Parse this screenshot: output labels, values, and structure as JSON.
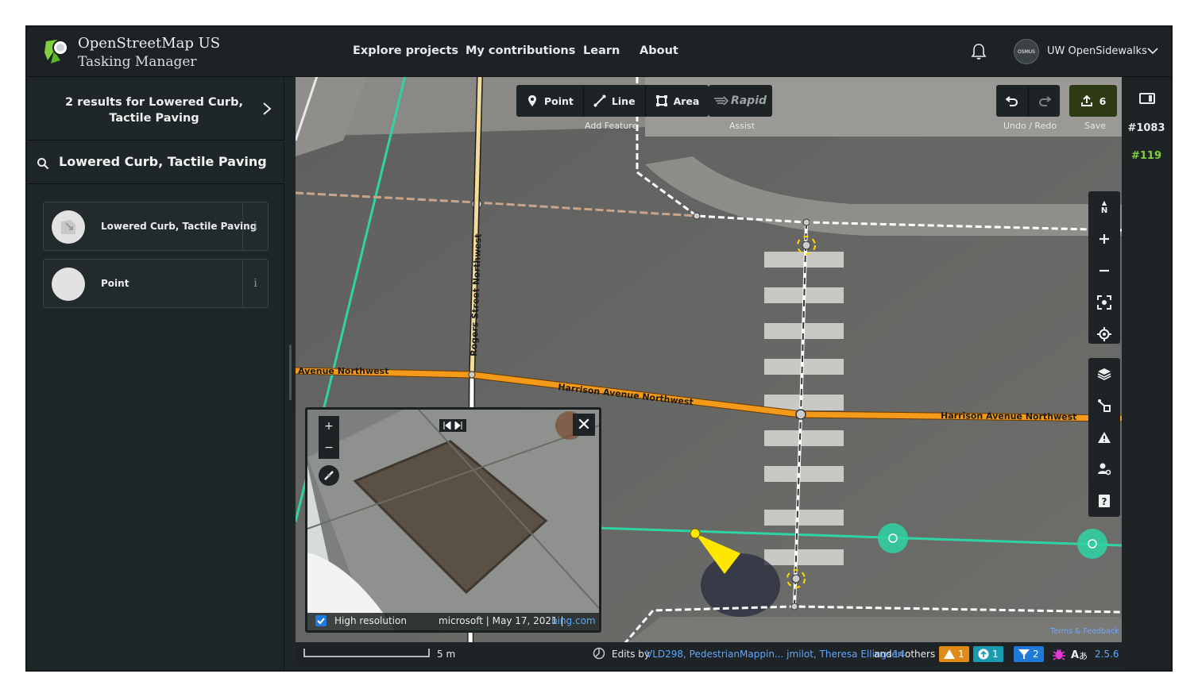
{
  "header": {
    "brand_line1": "OpenStreetMap US",
    "brand_line2": "Tasking Manager",
    "nav": [
      "Explore projects",
      "My contributions",
      "Learn",
      "About"
    ],
    "org_name": "UW OpenSidewalks",
    "avatar_text": "OSMUS"
  },
  "sidebar": {
    "results_title": "2 results for Lowered Curb, Tactile Paving",
    "search_value": "Lowered Curb, Tactile Paving",
    "presets": [
      {
        "label": "Lowered Curb, Tactile Paving",
        "info": "i"
      },
      {
        "label": "Point",
        "info": "i"
      }
    ]
  },
  "toolbar": {
    "point": "Point",
    "line": "Line",
    "area": "Area",
    "add_feature": "Add Feature",
    "rapid": "Rapid",
    "assist": "Assist",
    "undo_redo": "Undo / Redo",
    "save": "Save",
    "save_count": "6"
  },
  "map": {
    "labels": {
      "avenue_nw": "Avenue Northwest",
      "harrison1": "Harrison Avenue Northwest",
      "harrison2": "Harrison Avenue Northwest",
      "rogers": "Rogers Street Northwest"
    },
    "compass": "N",
    "terms": "Terms & Feedback"
  },
  "viewer": {
    "high_res": "High resolution",
    "source": "microsoft | May 17, 2021 |",
    "bing": "bing.com",
    "close": "✕",
    "zoom_in": "+",
    "zoom_out": "−"
  },
  "footer": {
    "scale": "5 m",
    "edits_by": "Edits by",
    "users": "VLD298, PedestrianMappin... jmilot, Theresa Ellingsen",
    "and": "and",
    "others_count": "14",
    "others": "others",
    "warnings": "1",
    "issues": "1",
    "filters": "2",
    "version": "2.5.6"
  },
  "right_panel": {
    "project_id": "#1083",
    "task_id": "#119"
  },
  "colors": {
    "accent_green": "#7fcf3f",
    "road_orange": "#f39a1a",
    "footway_teal": "#2fd4a4",
    "warning": "#e08a1a",
    "issue": "#1b9bb0",
    "filter": "#1e7ad6"
  }
}
